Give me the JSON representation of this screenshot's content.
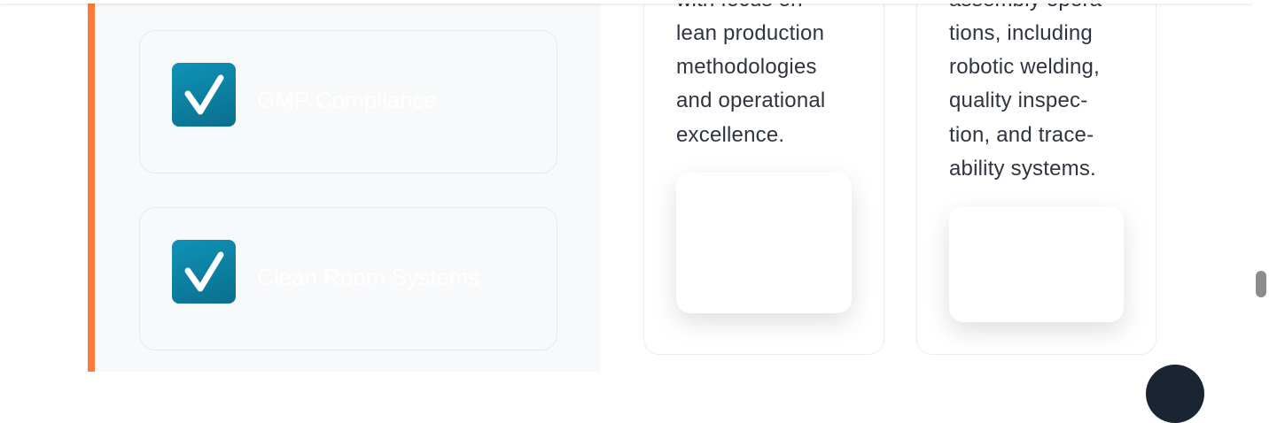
{
  "features": [
    {
      "label": "GMP Compliance",
      "icon": "checkmark-icon"
    },
    {
      "label": "Clean Room Systems",
      "icon": "checkmark-icon"
    }
  ],
  "cards": [
    {
      "lines": [
        "with focus on",
        "lean production",
        "methodologies",
        "and operational",
        "excellence."
      ]
    },
    {
      "lines": [
        "assembly opera-",
        "tions, including",
        "robotic welding,",
        "quality inspec-",
        "tion, and trace-",
        "ability systems."
      ]
    }
  ],
  "colors": {
    "accent": "#ff7a3a",
    "check_gradient_start": "#0f93b8",
    "check_gradient_end": "#0b6e8d",
    "text": "#2f3440"
  }
}
